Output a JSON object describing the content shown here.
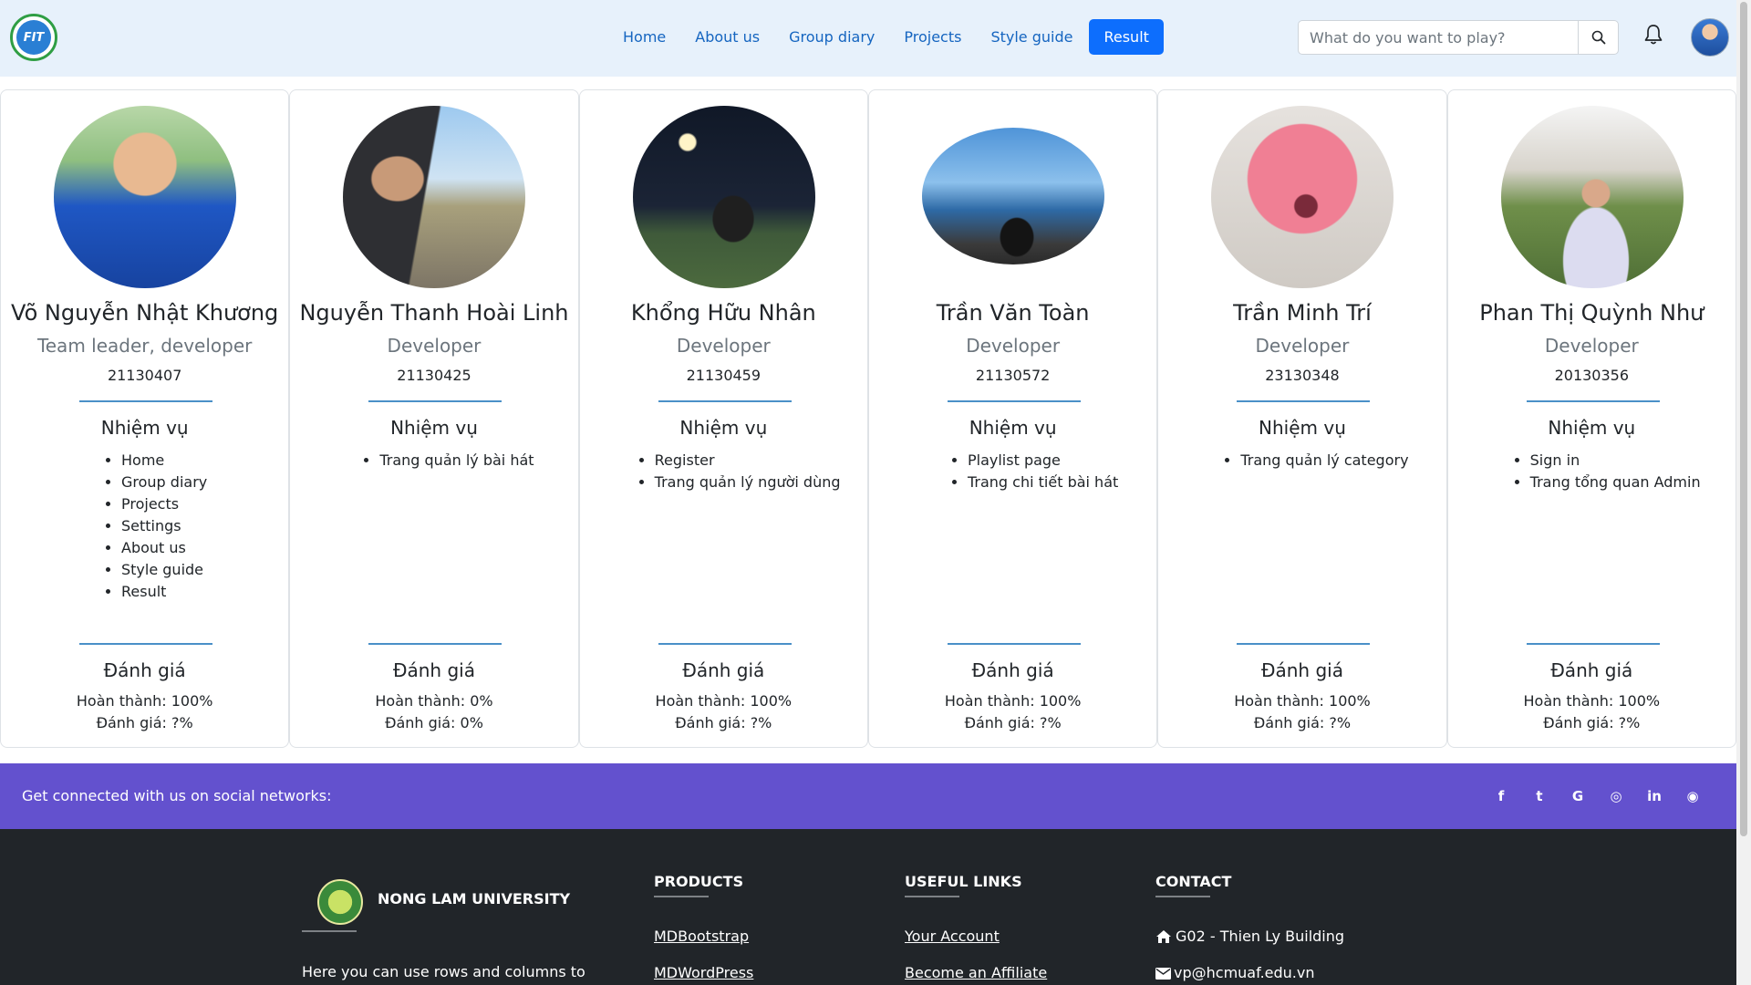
{
  "navbar": {
    "logo_text": "FIT",
    "links": [
      {
        "label": "Home"
      },
      {
        "label": "About us"
      },
      {
        "label": "Group diary"
      },
      {
        "label": "Projects"
      },
      {
        "label": "Style guide"
      },
      {
        "label": "Result",
        "active": true
      }
    ],
    "search_placeholder": "What do you want to play?",
    "icons": [
      "search-icon",
      "bell-icon",
      "user-avatar"
    ]
  },
  "team": [
    {
      "name": "Võ Nguyễn Nhật Khương",
      "role": "Team leader, developer",
      "id": "21130407",
      "tasks_title": "Nhiệm vụ",
      "tasks": [
        "Home",
        "Group diary",
        "Projects",
        "Settings",
        "About us",
        "Style guide",
        "Result"
      ],
      "rating_title": "Đánh giá",
      "completion": "Hoàn thành: 100%",
      "rating": "Đánh giá: ?%"
    },
    {
      "name": "Nguyễn Thanh Hoài Linh",
      "role": "Developer",
      "id": "21130425",
      "tasks_title": "Nhiệm vụ",
      "tasks": [
        "Trang quản lý bài hát"
      ],
      "rating_title": "Đánh giá",
      "completion": "Hoàn thành: 0%",
      "rating": "Đánh giá: 0%"
    },
    {
      "name": "Khổng Hữu Nhân",
      "role": "Developer",
      "id": "21130459",
      "tasks_title": "Nhiệm vụ",
      "tasks": [
        "Register",
        "Trang quản lý người dùng"
      ],
      "rating_title": "Đánh giá",
      "completion": "Hoàn thành: 100%",
      "rating": "Đánh giá: ?%"
    },
    {
      "name": "Trần Văn Toàn",
      "role": "Developer",
      "id": "21130572",
      "tasks_title": "Nhiệm vụ",
      "tasks": [
        "Playlist page",
        "Trang chi tiết bài hát"
      ],
      "rating_title": "Đánh giá",
      "completion": "Hoàn thành: 100%",
      "rating": "Đánh giá: ?%"
    },
    {
      "name": "Trần Minh Trí",
      "role": "Developer",
      "id": "23130348",
      "tasks_title": "Nhiệm vụ",
      "tasks": [
        "Trang quản lý category"
      ],
      "rating_title": "Đánh giá",
      "completion": "Hoàn thành: 100%",
      "rating": "Đánh giá: ?%"
    },
    {
      "name": "Phan Thị Quỳnh Như",
      "role": "Developer",
      "id": "20130356",
      "tasks_title": "Nhiệm vụ",
      "tasks": [
        "Sign in",
        "Trang tổng quan Admin"
      ],
      "rating_title": "Đánh giá",
      "completion": "Hoàn thành: 100%",
      "rating": "Đánh giá: ?%"
    }
  ],
  "social": {
    "text": "Get connected with us on social networks:",
    "icons": [
      {
        "name": "facebook-icon",
        "glyph": "f"
      },
      {
        "name": "twitter-icon",
        "glyph": "t"
      },
      {
        "name": "google-icon",
        "glyph": "G"
      },
      {
        "name": "instagram-icon",
        "glyph": "◎"
      },
      {
        "name": "linkedin-icon",
        "glyph": "in"
      },
      {
        "name": "github-icon",
        "glyph": "◉"
      }
    ]
  },
  "footer": {
    "university": "NONG LAM UNIVERSITY",
    "about_text": "Here you can use rows and columns to",
    "products_title": "PRODUCTS",
    "products": [
      "MDBootstrap",
      "MDWordPress"
    ],
    "links_title": "USEFUL LINKS",
    "links": [
      "Your Account",
      "Become an Affiliate"
    ],
    "contact_title": "CONTACT",
    "contact": [
      {
        "icon": "home-icon",
        "text": "G02 - Thien Ly Building"
      },
      {
        "icon": "envelope-icon",
        "text": "vp@hcmuaf.edu.vn"
      }
    ]
  },
  "colors": {
    "navbar_bg": "#e7f1fb",
    "accent": "#0d6efd",
    "social_bar": "#6351ce",
    "footer_bg": "#212529"
  }
}
